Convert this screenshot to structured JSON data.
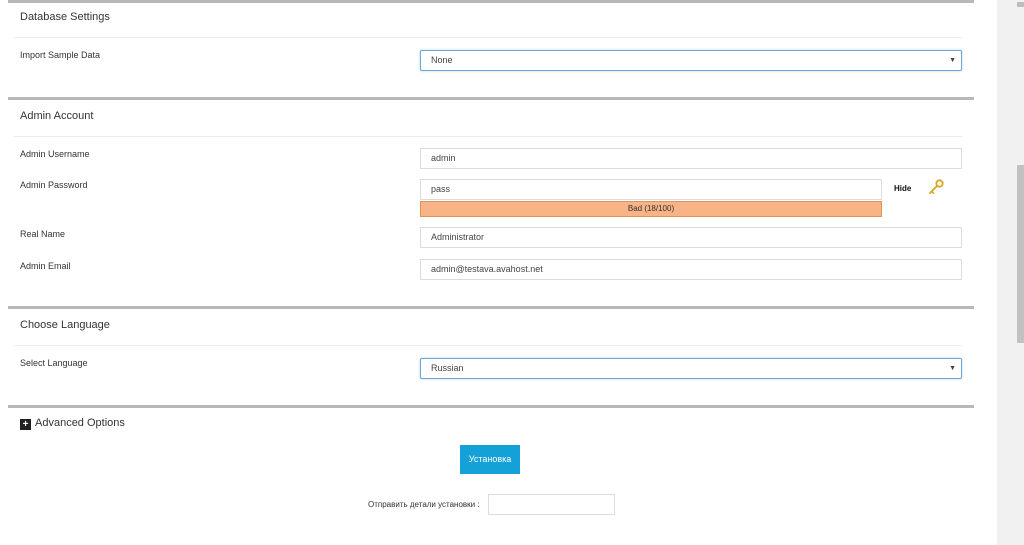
{
  "database": {
    "title": "Database Settings",
    "import_label": "Import Sample Data",
    "import_value": "None"
  },
  "admin": {
    "title": "Admin Account",
    "username_label": "Admin Username",
    "username_value": "admin",
    "password_label": "Admin Password",
    "password_value": "pass",
    "strength_text": "Bad (18/100)",
    "strength_level": 0.18,
    "hide_label": "Hide",
    "key_icon": "key-icon",
    "realname_label": "Real Name",
    "realname_value": "Administrator",
    "email_label": "Admin Email",
    "email_value": "admin@testava.avahost.net"
  },
  "language": {
    "title": "Choose Language",
    "select_label": "Select Language",
    "select_value": "Russian"
  },
  "advanced": {
    "label": "Advanced Options",
    "icon": "plus-square-icon"
  },
  "actions": {
    "install_label": "Установка",
    "send_details_label": "Отправить детали установки :"
  },
  "colors": {
    "accent": "#14a1d8",
    "strength_bad": "#f8b487",
    "select_border": "#6fa7d6"
  }
}
